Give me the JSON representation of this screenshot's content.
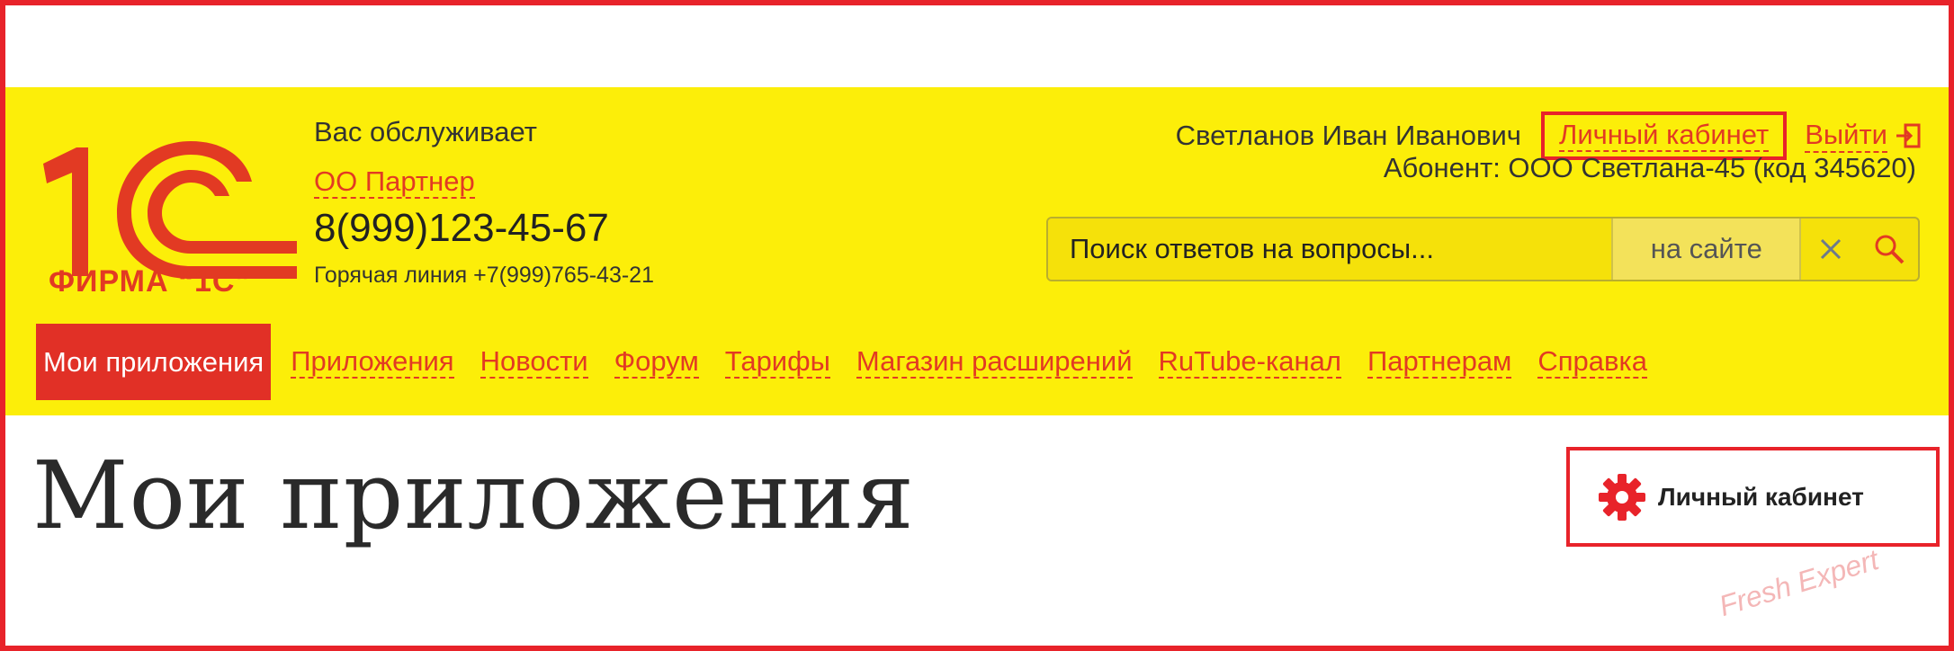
{
  "colors": {
    "header_bg": "#fcee09",
    "accent_red": "#e23a23",
    "highlight_border": "#e8232a",
    "active_nav_bg": "#e13026",
    "text_dark": "#2a2a2a"
  },
  "logo": {
    "icon": "firm-1c-logo-icon",
    "text": "ФИРМА “1С”"
  },
  "service": {
    "served_by": "Вас обслуживает",
    "partner_name": "ОО Партнер",
    "phone": "8(999)123-45-67",
    "hotline": "Горячая линия +7(999)765-43-21"
  },
  "user": {
    "name": "Светланов Иван Иванович",
    "cabinet_link": "Личный кабинет",
    "logout": "Выйти",
    "logout_icon": "logout-icon",
    "abonent": "Абонент: ООО Светлана-45 (код 345620)"
  },
  "search": {
    "placeholder": "Поиск ответов на вопросы...",
    "scope": "на сайте",
    "clear_icon": "close-icon",
    "search_icon": "search-icon"
  },
  "nav": {
    "active": "Мои приложения",
    "items": [
      "Приложения",
      "Новости",
      "Форум",
      "Тарифы",
      "Магазин расширений",
      "RuTube-канал",
      "Партнерам",
      "Справка"
    ]
  },
  "main": {
    "title": "Мои приложения",
    "cabinet_button": "Личный кабинет",
    "cabinet_button_icon": "gear-icon"
  },
  "watermark": "Fresh Expert"
}
